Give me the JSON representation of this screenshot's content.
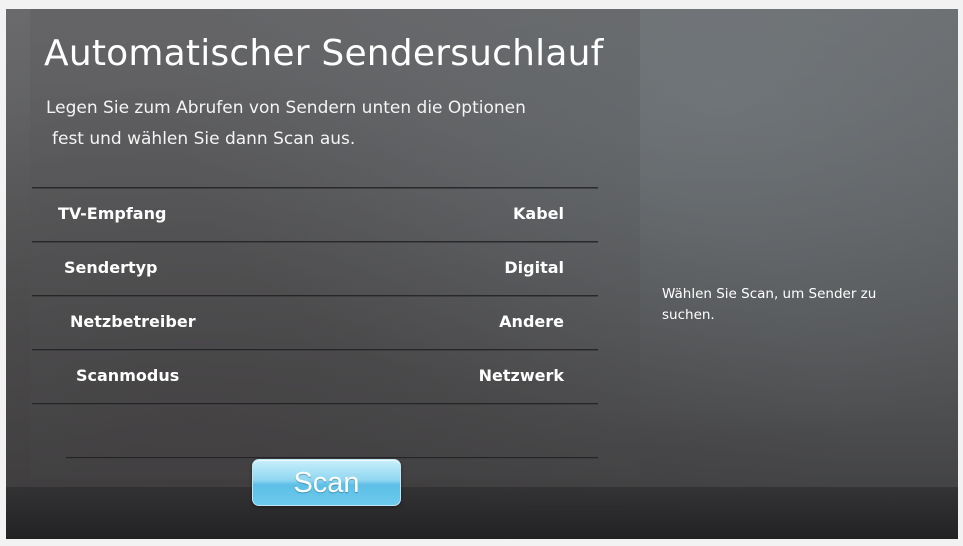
{
  "title": "Automatischer Sendersuchlauf",
  "description": {
    "line1": "Legen Sie zum Abrufen von Sendern unten die Optionen",
    "line2": "fest und wählen Sie dann Scan aus."
  },
  "options": [
    {
      "label": "TV-Empfang",
      "value": "Kabel"
    },
    {
      "label": "Sendertyp",
      "value": "Digital"
    },
    {
      "label": "Netzbetreiber",
      "value": "Andere"
    },
    {
      "label": "Scanmodus",
      "value": "Netzwerk"
    }
  ],
  "help_text": "Wählen Sie Scan, um Sender zu suchen.",
  "scan_button": {
    "label": "Scan"
  },
  "colors": {
    "background": "#5b5c5e",
    "text": "#ffffff",
    "button_accent": "#6ccaec"
  }
}
